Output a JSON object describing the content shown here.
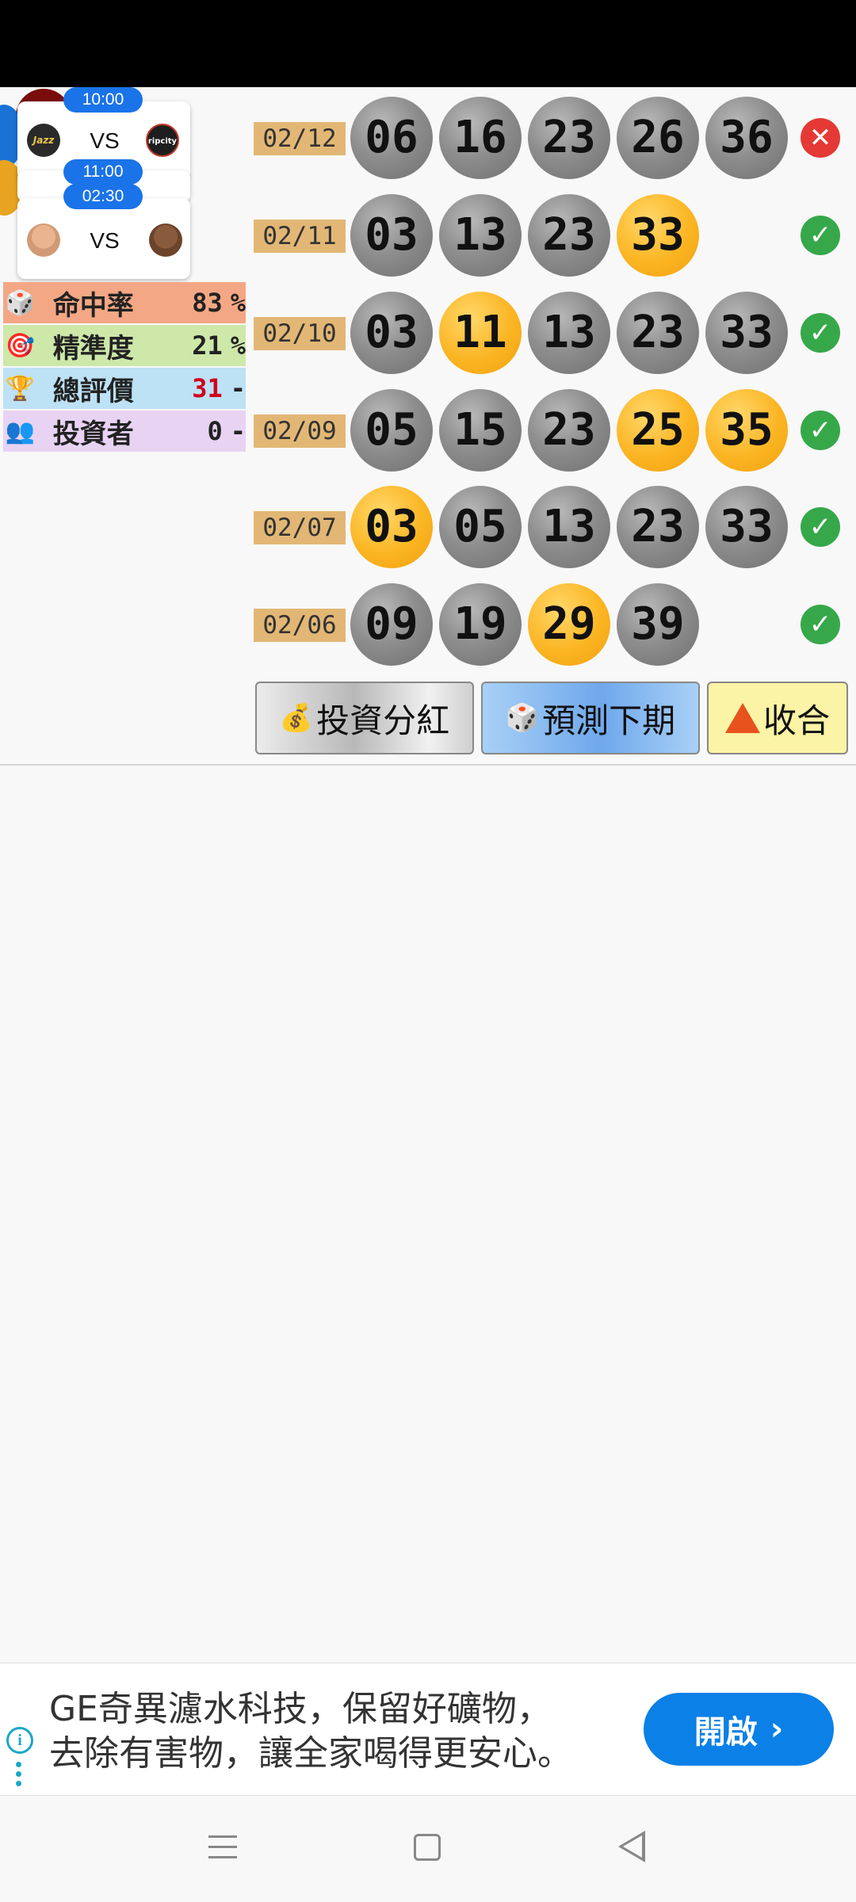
{
  "matches": [
    {
      "time": "10:00",
      "vs": "VS",
      "home_logo": "Jazz",
      "away_logo": "ripcity"
    },
    {
      "time": "11:00"
    },
    {
      "time": "02:30",
      "vs": "VS"
    }
  ],
  "stats": [
    {
      "label": "命中率",
      "value": "83",
      "unit": "%",
      "icon": "dice-icon",
      "value_color": "#222222"
    },
    {
      "label": "精準度",
      "value": "21",
      "unit": "%",
      "icon": "target-icon",
      "value_color": "#222222"
    },
    {
      "label": "總評價",
      "value": "31",
      "unit": "-",
      "icon": "trophy-icon",
      "value_color": "#d0021b"
    },
    {
      "label": "投資者",
      "value": "0",
      "unit": "-",
      "icon": "investors-icon",
      "value_color": "#222222"
    }
  ],
  "draws": [
    {
      "date": "02/12",
      "balls": [
        {
          "n": "06",
          "c": "gray"
        },
        {
          "n": "16",
          "c": "gray"
        },
        {
          "n": "23",
          "c": "gray"
        },
        {
          "n": "26",
          "c": "gray"
        },
        {
          "n": "36",
          "c": "gray"
        }
      ],
      "result": "miss"
    },
    {
      "date": "02/11",
      "balls": [
        {
          "n": "03",
          "c": "gray"
        },
        {
          "n": "13",
          "c": "gray"
        },
        {
          "n": "23",
          "c": "gray"
        },
        {
          "n": "33",
          "c": "gold"
        }
      ],
      "result": "hit"
    },
    {
      "date": "02/10",
      "balls": [
        {
          "n": "03",
          "c": "gray"
        },
        {
          "n": "11",
          "c": "gold"
        },
        {
          "n": "13",
          "c": "gray"
        },
        {
          "n": "23",
          "c": "gray"
        },
        {
          "n": "33",
          "c": "gray"
        }
      ],
      "result": "hit"
    },
    {
      "date": "02/09",
      "balls": [
        {
          "n": "05",
          "c": "gray"
        },
        {
          "n": "15",
          "c": "gray"
        },
        {
          "n": "23",
          "c": "gray"
        },
        {
          "n": "25",
          "c": "gold"
        },
        {
          "n": "35",
          "c": "gold"
        }
      ],
      "result": "hit"
    },
    {
      "date": "02/07",
      "balls": [
        {
          "n": "03",
          "c": "gold"
        },
        {
          "n": "05",
          "c": "gray"
        },
        {
          "n": "13",
          "c": "gray"
        },
        {
          "n": "23",
          "c": "gray"
        },
        {
          "n": "33",
          "c": "gray"
        }
      ],
      "result": "hit"
    },
    {
      "date": "02/06",
      "balls": [
        {
          "n": "09",
          "c": "gray"
        },
        {
          "n": "19",
          "c": "gray"
        },
        {
          "n": "29",
          "c": "gold"
        },
        {
          "n": "39",
          "c": "gray"
        }
      ],
      "result": "hit"
    }
  ],
  "buttons": {
    "invest": "投資分紅",
    "predict": "預測下期",
    "fold": "收合"
  },
  "ad": {
    "line1": "GE奇異濾水科技，保留好礦物，",
    "line2": "去除有害物，讓全家喝得更安心。",
    "cta": "開啟"
  },
  "colors": {
    "ball_gray": "#8e8e8e",
    "ball_gold": "#fbb523",
    "hit": "#36a84a",
    "miss": "#e53935",
    "ad_cta": "#0b80e6"
  }
}
